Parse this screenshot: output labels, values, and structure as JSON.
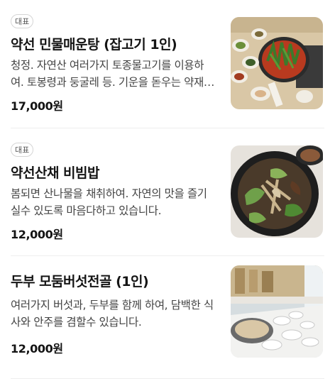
{
  "menu_items": [
    {
      "badge": "대표",
      "title": "약선 민물매운탕 (잡고기 1인)",
      "description": "청정. 자연산 여러가지 토종물고기를 이용하여. 토봉령과 둥굴레 등. 기운을 돋우는 약재를 넣어 끓였습니다.",
      "price": "17,000원",
      "image": "spicy-fish-stew-photo"
    },
    {
      "badge": "대표",
      "title": "약선산채 비빔밥",
      "description": "봄되면 산나물을 채취하여. 자연의 맛을 즐기실수 있도록 마음다하고 있습니다.",
      "price": "12,000원",
      "image": "wild-vegetable-bibimbap-photo"
    },
    {
      "title": "두부 모둠버섯전골 (1인)",
      "description": "여러가지 버섯과, 두부를 함께 하여, 담백한 식사와 안주를 겸할수 있습니다.",
      "price": "12,000원",
      "image": "tofu-mushroom-hotpot-photo"
    }
  ],
  "colors": {
    "title": "#141414",
    "description": "#444444",
    "badge_border": "#d5d5d5",
    "divider": "#eeeeee"
  }
}
